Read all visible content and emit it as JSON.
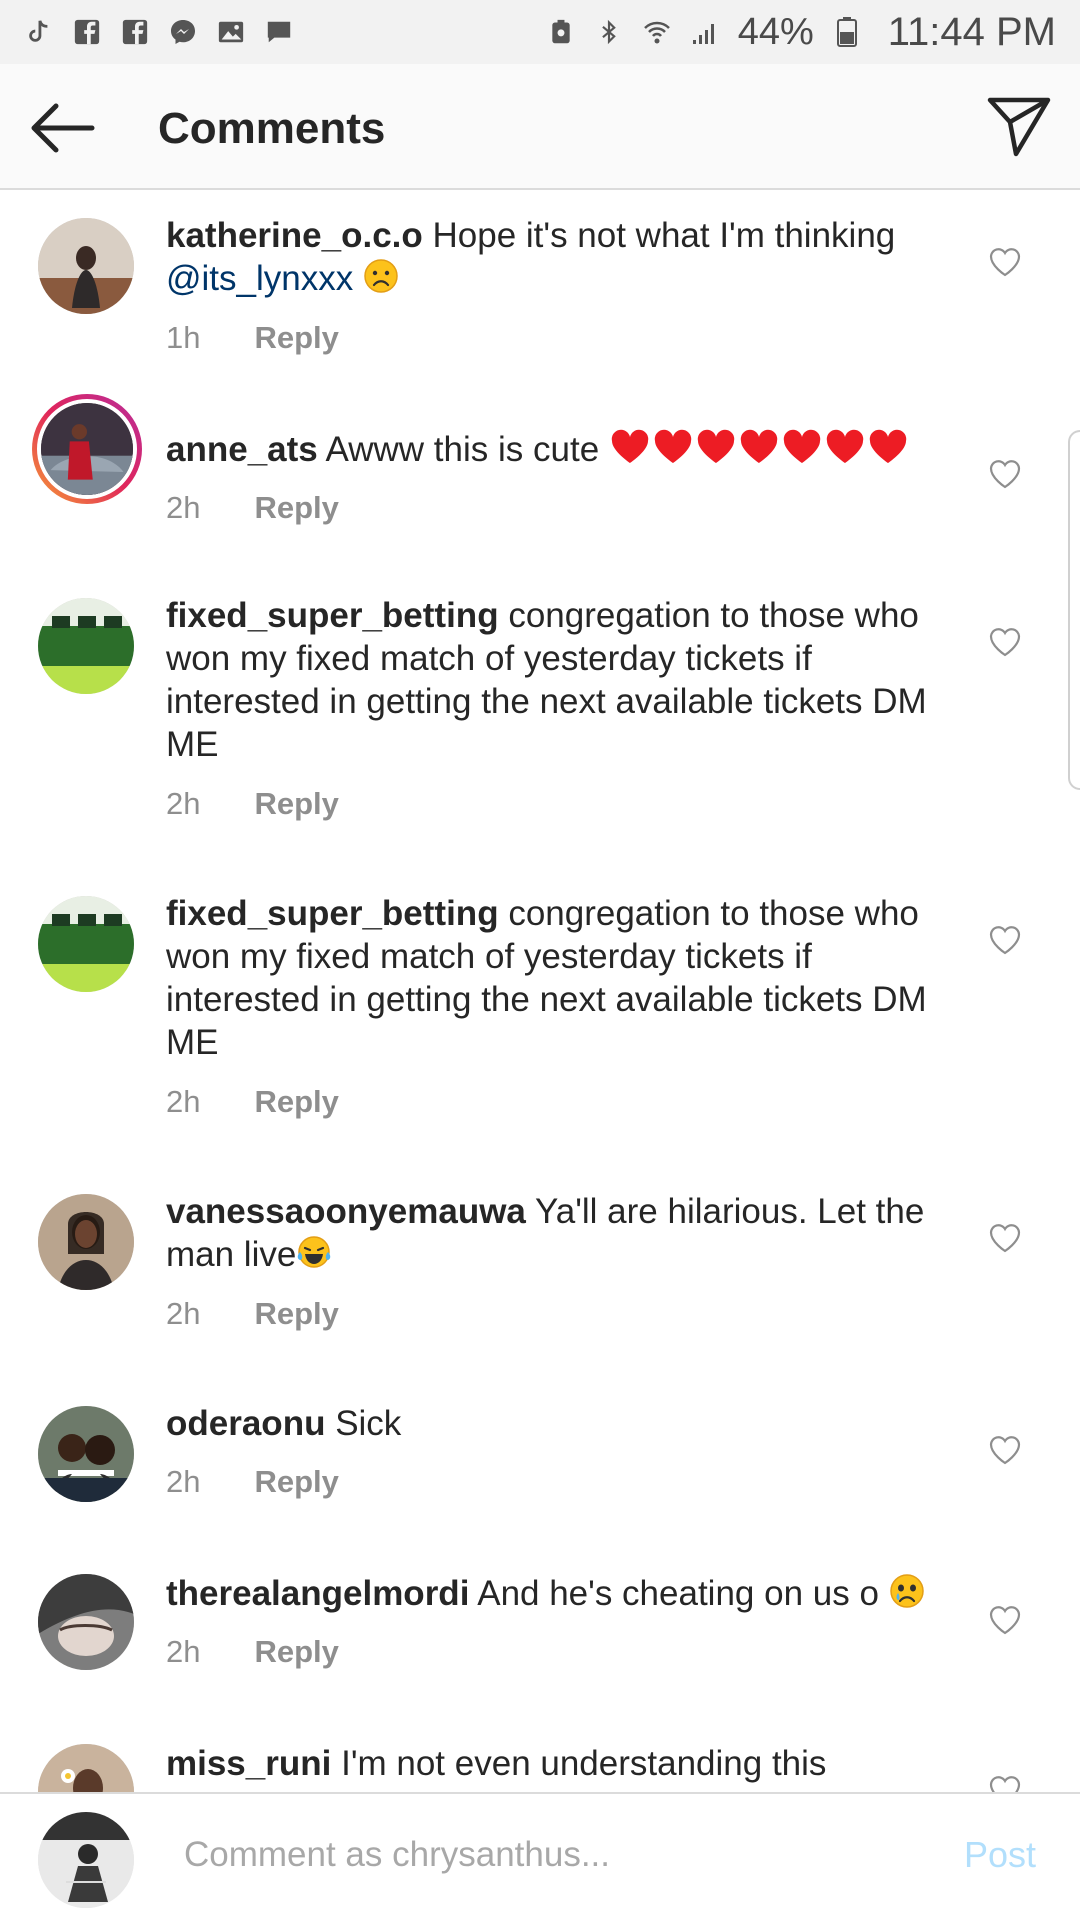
{
  "status_bar": {
    "battery": "44%",
    "time": "11:44 PM"
  },
  "header": {
    "title": "Comments"
  },
  "comments": [
    {
      "username": "katherine_o.c.o",
      "text": "Hope it's not what I'm thinking",
      "mention": "@its_lynxxx",
      "time": "1h",
      "reply": "Reply"
    },
    {
      "username": "anne_ats",
      "text": "Awww this is cute",
      "time": "2h",
      "reply": "Reply"
    },
    {
      "username": "fixed_super_betting",
      "text": "congregation to those who won my fixed match of yesterday tickets if interested in getting the next available tickets DM ME",
      "time": "2h",
      "reply": "Reply"
    },
    {
      "username": "fixed_super_betting",
      "text": "congregation to those who won my fixed match of yesterday tickets if interested in getting the next available tickets DM ME",
      "time": "2h",
      "reply": "Reply"
    },
    {
      "username": "vanessaoonyemauwa",
      "text": "Ya'll are hilarious. Let the man live",
      "time": "2h",
      "reply": "Reply"
    },
    {
      "username": "oderaonu",
      "text": "Sick",
      "time": "2h",
      "reply": "Reply"
    },
    {
      "username": "therealangelmordi",
      "text": "And he's cheating on us o",
      "time": "2h",
      "reply": "Reply"
    },
    {
      "username": "miss_runi",
      "text": "I'm not even understanding this"
    }
  ],
  "composer": {
    "placeholder": "Comment as chrysanthus...",
    "post_label": "Post"
  },
  "colors": {
    "mention": "#003569",
    "post_disabled": "#b2dffc",
    "heart_red": "#ed1c24"
  }
}
